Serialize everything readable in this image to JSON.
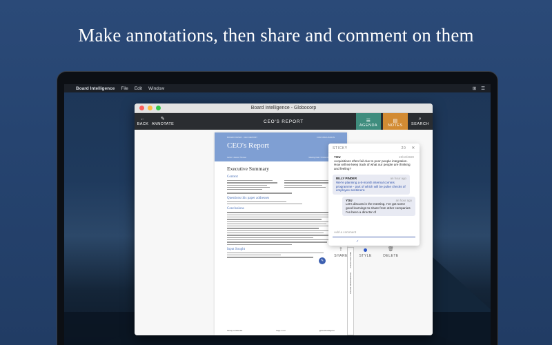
{
  "headline": "Make annotations, then share and comment on them",
  "menubar": {
    "apple": "",
    "app_name": "Board Intelligence",
    "items": [
      "File",
      "Edit",
      "Window"
    ],
    "right": [
      "⊞",
      "☰"
    ]
  },
  "window": {
    "title": "Board Intelligence - Globocorp",
    "toolbar": {
      "back_label": "BACK",
      "annotate_label": "ANNOTATE",
      "center_title": "CEO'S REPORT",
      "agenda_label": "AGENDA",
      "notes_label": "NOTES",
      "search_label": "SEARCH"
    }
  },
  "document": {
    "banner_top_left": "BOARD PAPER · CEO REPORT",
    "banner_top_right": "FOR DISCUSSION",
    "title": "CEO's Report",
    "meta_left": "Author: Jessica Thomas",
    "meta_right": "Meeting Date: 3 December 2020",
    "heading": "Executive Summary",
    "sections": [
      "Context",
      "Questions this paper addresses",
      "Conclusions",
      "Input Sought"
    ],
    "footer_left": "Strictly Confidential",
    "footer_center": "Page 1 of 3",
    "footer_right": "@boardintelligence",
    "strip_labels": [
      "MEETING INDEX",
      "BOARDROOM NOTES"
    ]
  },
  "sticky": {
    "header": "STICKY",
    "count": "20",
    "messages": [
      {
        "who": "YOU",
        "time": "19/10/2020",
        "text": "Acquisitions often fail due to poor people integration. How will we keep track of what our people are thinking and feeling?"
      },
      {
        "who": "BILLY PINDER",
        "time": "an hour ago",
        "text": "We're planning a 6-month internal comms programme - part of which will be pulse checks of employee sentiment."
      },
      {
        "who": "YOU",
        "time": "an hour ago",
        "text": "Let's discuss in the meeting. I've got some good learnings to share from other companies I've been a director of"
      }
    ],
    "input_placeholder": "Add a comment",
    "actions": {
      "share": "SHARE",
      "style": "STYLE",
      "delete": "DELETE"
    }
  },
  "colors": {
    "agenda": "#3f8d7e",
    "notes": "#d28b33",
    "accent": "#4a64b0"
  }
}
